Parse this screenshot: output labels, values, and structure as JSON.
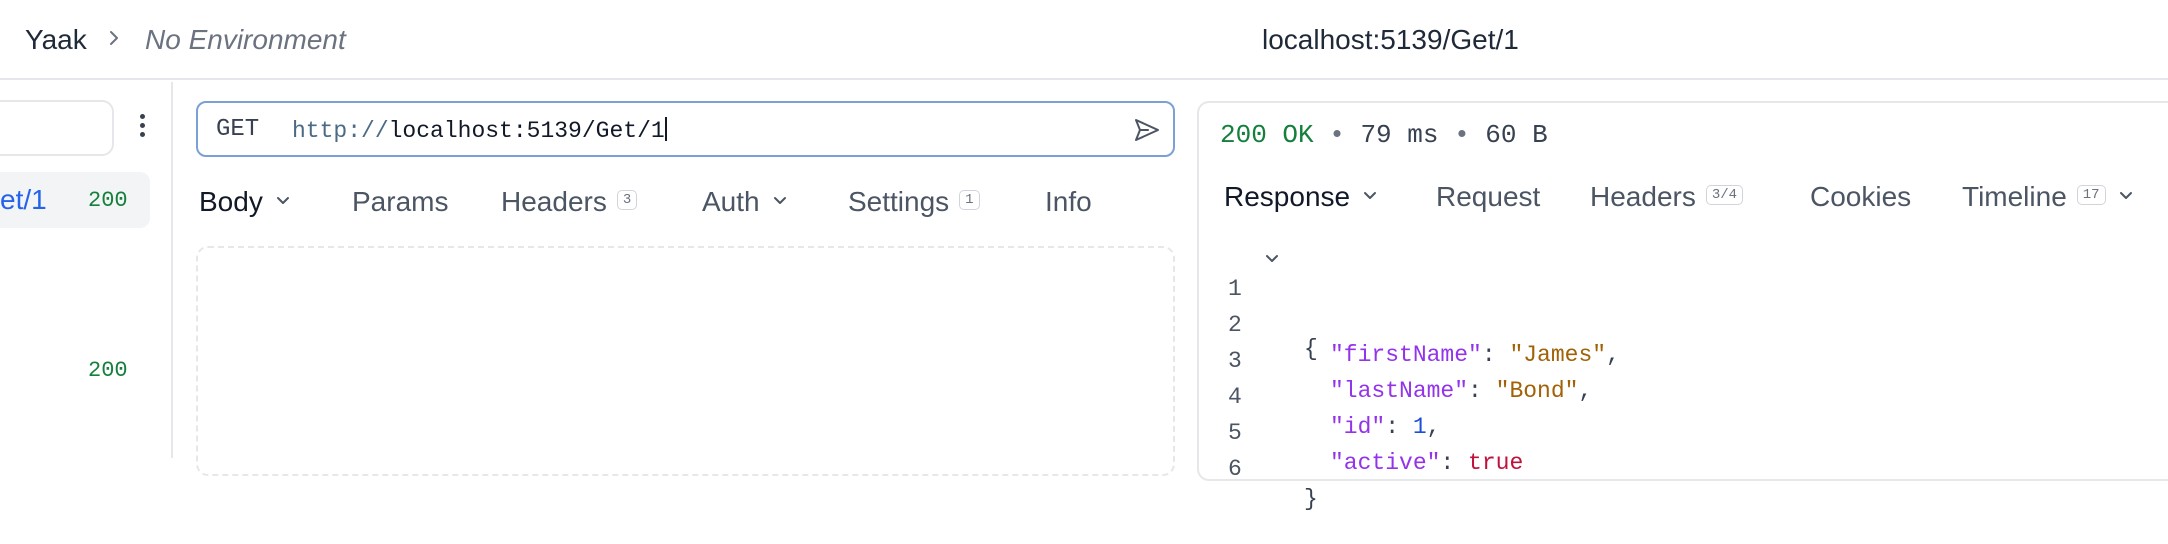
{
  "titlebar": {
    "app_name": "Yaak",
    "environment": "No Environment",
    "window_title": "localhost:5139/Get/1"
  },
  "sidebar": {
    "items": [
      {
        "label": "et/1",
        "status": "200"
      },
      {
        "label": "",
        "status": "200"
      }
    ]
  },
  "request": {
    "method": "GET",
    "url_protocol": "http://",
    "url_rest": "localhost:5139/Get/1",
    "tabs": [
      {
        "label": "Body"
      },
      {
        "label": "Params"
      },
      {
        "label": "Headers",
        "badge": "3"
      },
      {
        "label": "Auth"
      },
      {
        "label": "Settings",
        "badge": "1"
      },
      {
        "label": "Info"
      }
    ]
  },
  "response": {
    "status": "200 OK",
    "time": "79 ms",
    "size": "60 B",
    "separator": "•",
    "tabs": [
      {
        "label": "Response"
      },
      {
        "label": "Request"
      },
      {
        "label": "Headers",
        "badge": "3/4"
      },
      {
        "label": "Cookies"
      },
      {
        "label": "Timeline",
        "badge": "17"
      }
    ],
    "body_lines": [
      {
        "n": "1",
        "open": "{"
      },
      {
        "n": "2",
        "key": "\"firstName\"",
        "colon": ": ",
        "value": "\"James\"",
        "comma": ","
      },
      {
        "n": "3",
        "key": "\"lastName\"",
        "colon": ": ",
        "value": "\"Bond\"",
        "comma": ","
      },
      {
        "n": "4",
        "key": "\"id\"",
        "colon": ": ",
        "value": "1",
        "comma": ","
      },
      {
        "n": "5",
        "key": "\"active\"",
        "colon": ": ",
        "value": "true"
      },
      {
        "n": "6",
        "close": "}"
      }
    ]
  },
  "colors": {
    "status_ok": "#15803d",
    "link": "#2563eb",
    "json_key": "#9333ea",
    "json_string": "#a16207",
    "json_number": "#1d4ed8",
    "json_bool": "#be123c"
  },
  "icons": [
    "chevron-right-icon",
    "more-vertical-icon",
    "send-icon",
    "chevron-down-icon"
  ]
}
